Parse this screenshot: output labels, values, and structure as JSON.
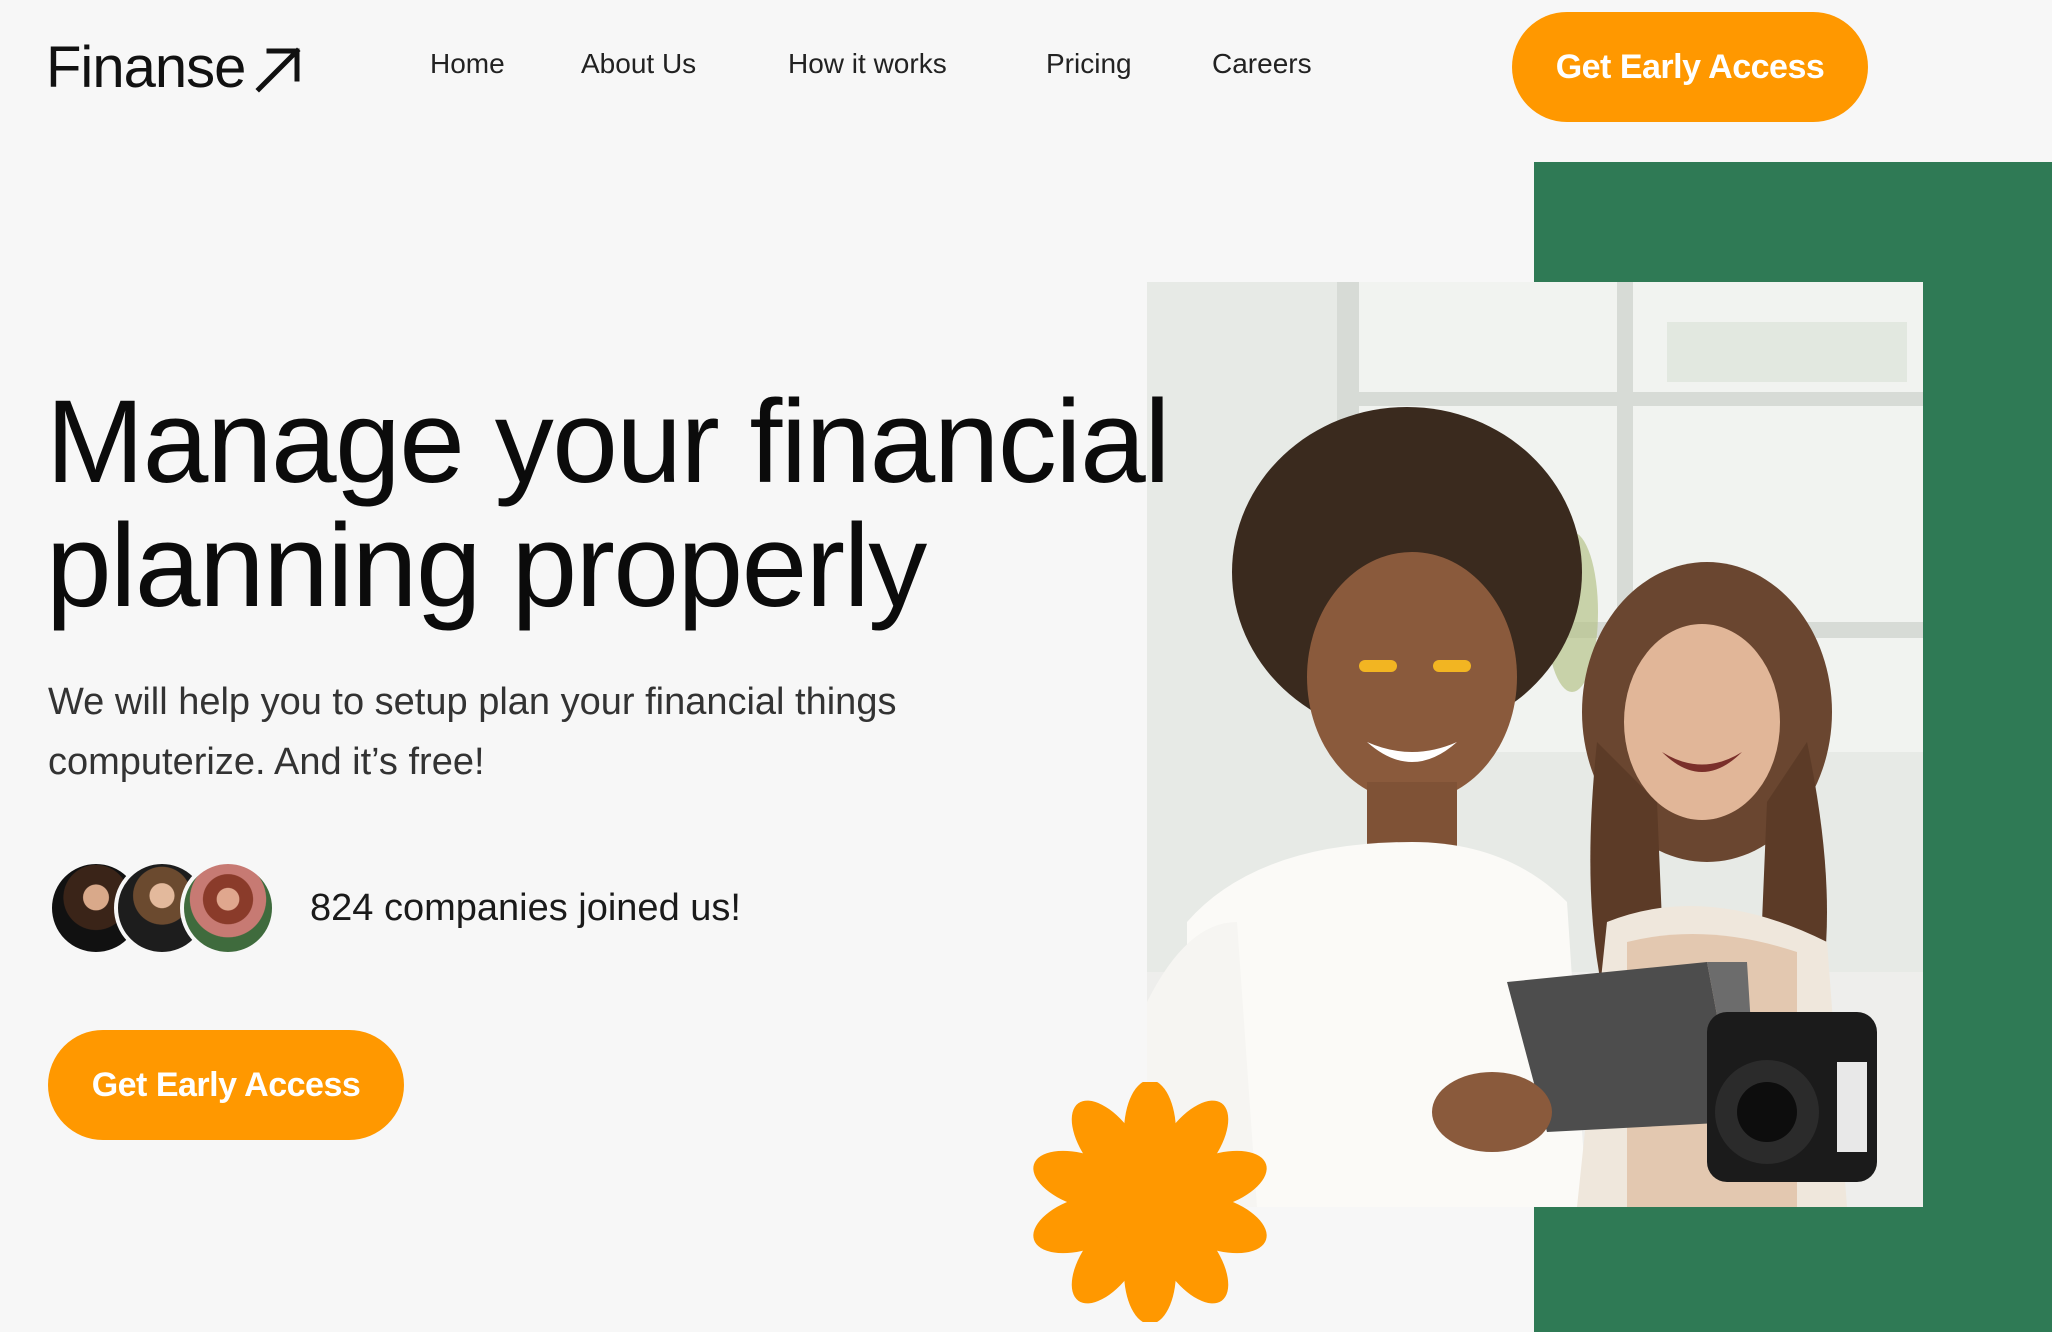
{
  "nav": {
    "logo_text": "Finanse",
    "links": [
      "Home",
      "About Us",
      "How it works",
      "Pricing",
      "Careers"
    ],
    "cta_label": "Get Early Access"
  },
  "hero": {
    "headline_line1": "Manage your financial",
    "headline_line2": "planning properly",
    "subtext": "We will help you to setup plan your financial things computerize. And it’s free!",
    "social_proof": "824 companies joined us!",
    "cta_label": "Get Early Access"
  },
  "colors": {
    "accent": "#ff9800",
    "green": "#2f7a55",
    "background": "#f7f7f7"
  },
  "icons": [
    "arrow-up-right-icon",
    "flower-icon"
  ]
}
